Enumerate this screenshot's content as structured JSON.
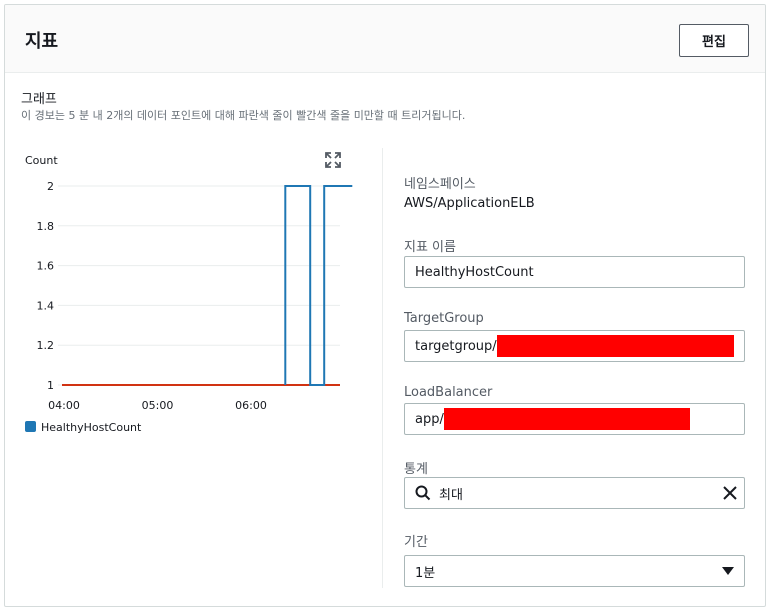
{
  "header": {
    "title": "지표",
    "edit_label": "편집"
  },
  "graph": {
    "title": "그래프",
    "description": "이 경보는 5 분 내 2개의 데이터 포인트에 대해 파란색 줄이 빨간색 줄을 미만할 때 트리거됩니다."
  },
  "chart_data": {
    "type": "line",
    "ylabel": "Count",
    "ylim": [
      1,
      2
    ],
    "yticks": [
      "2",
      "1.8",
      "1.6",
      "1.4",
      "1.2",
      "1"
    ],
    "xticks": [
      "04:00",
      "05:00",
      "06:00"
    ],
    "series": [
      {
        "name": "HealthyHostCount",
        "color": "#1f77b4",
        "points": [
          [
            "06:22",
            1
          ],
          [
            "06:22",
            2
          ],
          [
            "06:38",
            2
          ],
          [
            "06:38",
            1
          ],
          [
            "06:47",
            1
          ],
          [
            "06:47",
            2
          ],
          [
            "07:05",
            2
          ]
        ]
      }
    ],
    "threshold": {
      "value": 1,
      "color": "#d13212"
    },
    "grid": true,
    "legend": "bottom-left"
  },
  "fields": {
    "namespace_label": "네임스페이스",
    "namespace_value": "AWS/ApplicationELB",
    "metric_name_label": "지표 이름",
    "metric_name_value": "HealthyHostCount",
    "target_group_label": "TargetGroup",
    "target_group_value": "targetgroup/",
    "load_balancer_label": "LoadBalancer",
    "load_balancer_value": "app/",
    "statistic_label": "통계",
    "statistic_value": "최대",
    "period_label": "기간",
    "period_value": "1분"
  }
}
